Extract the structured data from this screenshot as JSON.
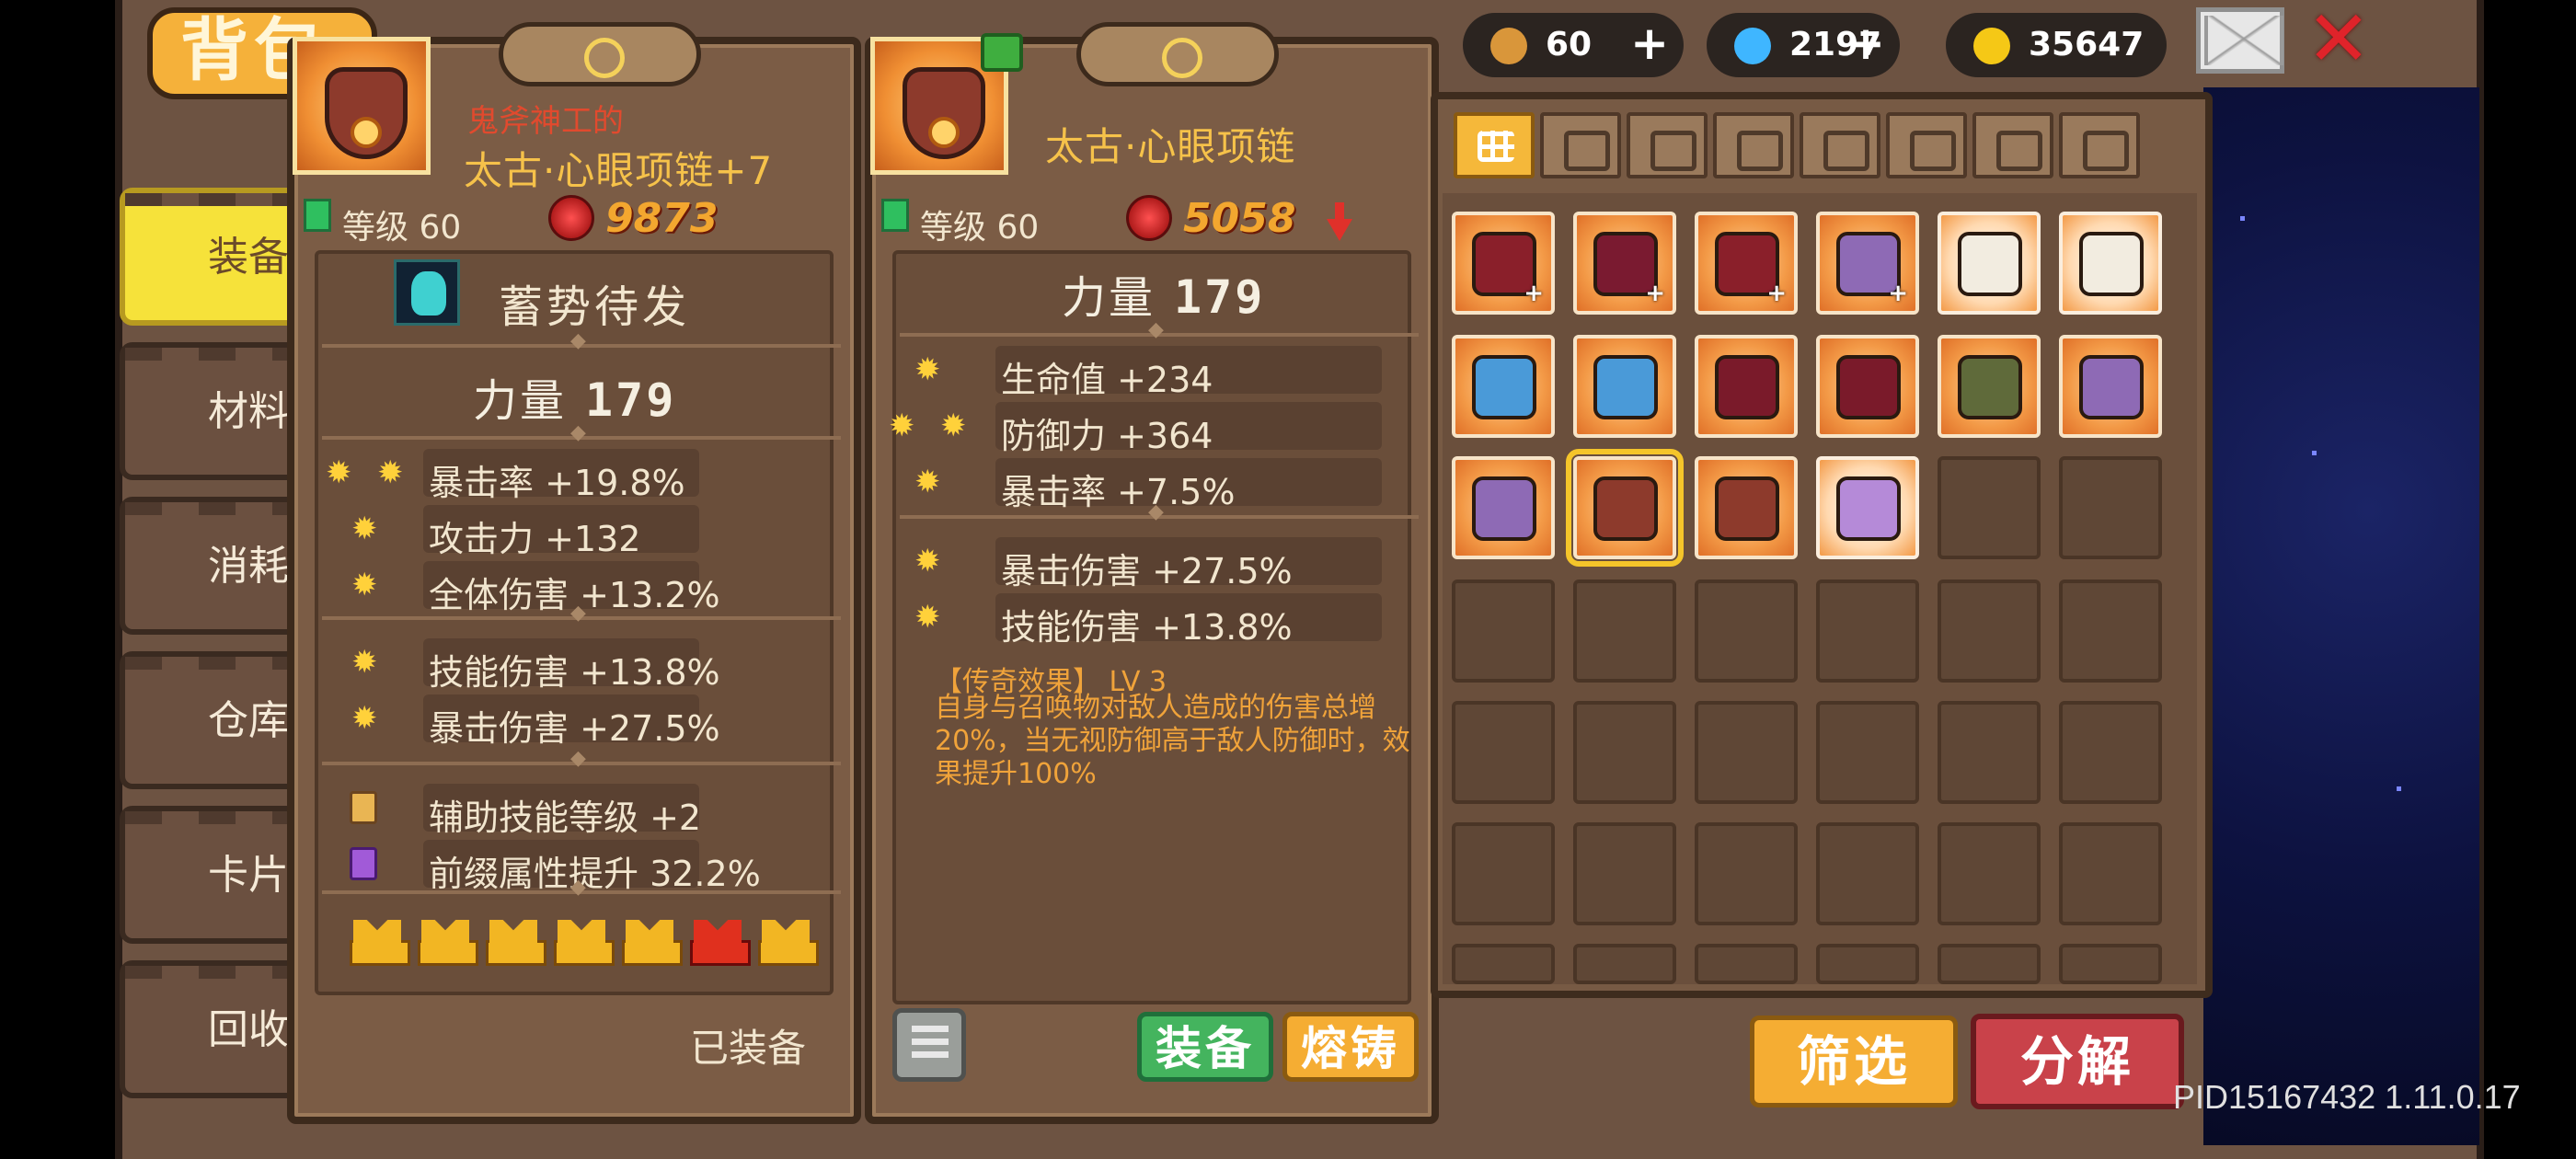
{
  "page_title": "背包",
  "nav": [
    {
      "label": "装备"
    },
    {
      "label": "材料"
    },
    {
      "label": "消耗品"
    },
    {
      "label": "仓库"
    },
    {
      "label": "卡片"
    },
    {
      "label": "回收站"
    }
  ],
  "currency": {
    "bag_count": "60",
    "gems": "2197",
    "gold": "35647"
  },
  "equipped_item": {
    "prefix": "鬼斧神工的",
    "name": "太古·心眼项链+7",
    "level": "等级 60",
    "power": "9873",
    "skill": "蓄势待发",
    "main_stat_label": "力量",
    "main_stat_value": "179",
    "stats_group1": [
      {
        "text": "暴击率 +19.8%",
        "gems": 2
      },
      {
        "text": "攻击力 +132",
        "gems": 1
      },
      {
        "text": "全体伤害 +13.2%",
        "gems": 1
      }
    ],
    "stats_group2": [
      {
        "text": "技能伤害 +13.8%",
        "gems": 1
      },
      {
        "text": "暴击伤害 +27.5%",
        "gems": 1
      }
    ],
    "stats_group3": [
      {
        "text": "辅助技能等级 +2",
        "emblem": "gold"
      },
      {
        "text": "前缀属性提升 32.2%",
        "emblem": "purple"
      }
    ],
    "crowns": [
      "gold",
      "gold",
      "gold",
      "gold",
      "gold",
      "red",
      "gold"
    ],
    "status": "已装备"
  },
  "compare_item": {
    "name": "太古·心眼项链",
    "level": "等级 60",
    "power": "5058",
    "main_stat_label": "力量",
    "main_stat_value": "179",
    "stats_group1": [
      {
        "text": "生命值 +234",
        "gems": 1
      },
      {
        "text": "防御力 +364",
        "gems": 2
      },
      {
        "text": "暴击率 +7.5%",
        "gems": 1
      }
    ],
    "stats_group2": [
      {
        "text": "暴击伤害 +27.5%",
        "gems": 1
      },
      {
        "text": "技能伤害 +13.8%",
        "gems": 1
      }
    ],
    "legend_title": "【传奇效果】 LV 3",
    "legend_desc": "自身与召唤物对敌人造成的伤害总增20%，当无视防御高于敌人防御时，效果提升100%",
    "equip_button": "装备",
    "smelt_button": "熔铸"
  },
  "filter_tabs": [
    "all-icon",
    "weapon-icon",
    "armor-icon",
    "helmet-icon",
    "boots-icon",
    "necklace-icon",
    "ring-icon",
    "gear-icon"
  ],
  "inventory": {
    "rows": [
      [
        {
          "art": "#8a1f2a",
          "plus": "+"
        },
        {
          "art": "#7a1a30",
          "plus": "+"
        },
        {
          "art": "#8a1f2a",
          "plus": "+"
        },
        {
          "art": "#8e6ab5",
          "plus": "+"
        },
        {
          "art": "#f2ece0",
          "plus": ""
        },
        {
          "art": "#f2ece0",
          "plus": ""
        }
      ],
      [
        {
          "art": "#4a9ad8",
          "plus": ""
        },
        {
          "art": "#4a9ad8",
          "plus": ""
        },
        {
          "art": "#7a1a2a",
          "plus": ""
        },
        {
          "art": "#7a1a2a",
          "plus": ""
        },
        {
          "art": "#5f6a3a",
          "plus": ""
        },
        {
          "art": "#8e6ab5",
          "plus": ""
        }
      ],
      [
        {
          "art": "#8e6ab5",
          "plus": ""
        },
        {
          "art": "#8d3a2c",
          "plus": "",
          "selected": true
        },
        {
          "art": "#8d3a2c",
          "plus": ""
        },
        {
          "art": "#b58ad8",
          "plus": ""
        }
      ]
    ]
  },
  "filter_button": "筛选",
  "decompose_button": "分解",
  "version": "PID15167432 1.11.0.17",
  "colors": {
    "accent": "#f5b13a",
    "danger": "#c9424a",
    "confirm": "#44b45e"
  }
}
